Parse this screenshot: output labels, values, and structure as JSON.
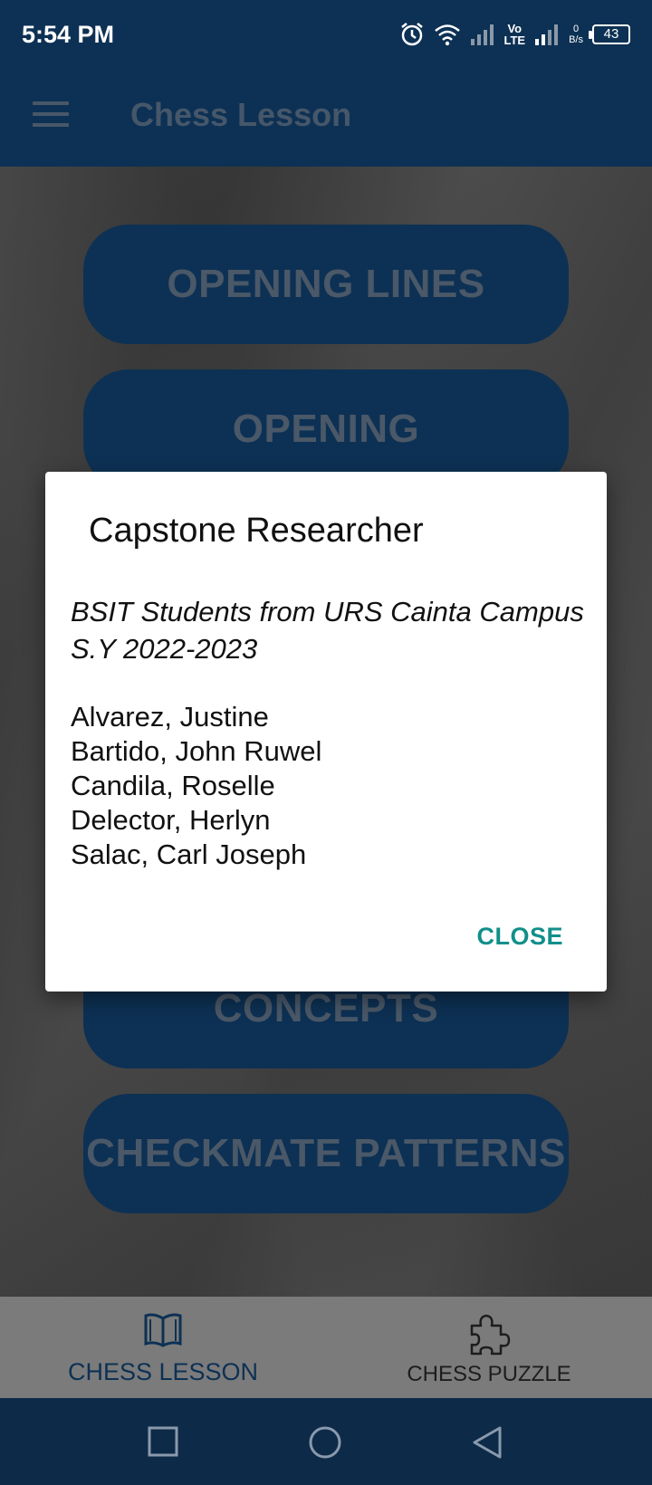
{
  "status_bar": {
    "time": "5:54 PM",
    "volte_top": "Vo",
    "volte_bottom": "LTE",
    "speed_value": "0",
    "speed_unit": "B/s",
    "battery": "43"
  },
  "app_bar": {
    "title": "Chess Lesson"
  },
  "lessons": [
    {
      "label": "OPENING LINES"
    },
    {
      "label": "OPENING"
    },
    {
      "label": "CONCEPTS"
    },
    {
      "label": "CHECKMATE PATTERNS"
    }
  ],
  "bottom_nav": {
    "items": [
      {
        "label": "CHESS LESSON",
        "icon": "book-icon",
        "active": true
      },
      {
        "label": "CHESS PUZZLE",
        "icon": "puzzle-icon",
        "active": false
      }
    ]
  },
  "dialog": {
    "title": "Capstone Researcher",
    "subtitle_line1": "BSIT Students from URS Cainta Campus",
    "subtitle_line2": "S.Y 2022-2023",
    "names": [
      "Alvarez, Justine",
      "Bartido, John Ruwel",
      "Candila, Roselle",
      "Delector, Herlyn",
      "Salac, Carl Joseph"
    ],
    "close_label": "CLOSE"
  },
  "colors": {
    "primary": "#0d3154",
    "accent": "#108f8a"
  }
}
